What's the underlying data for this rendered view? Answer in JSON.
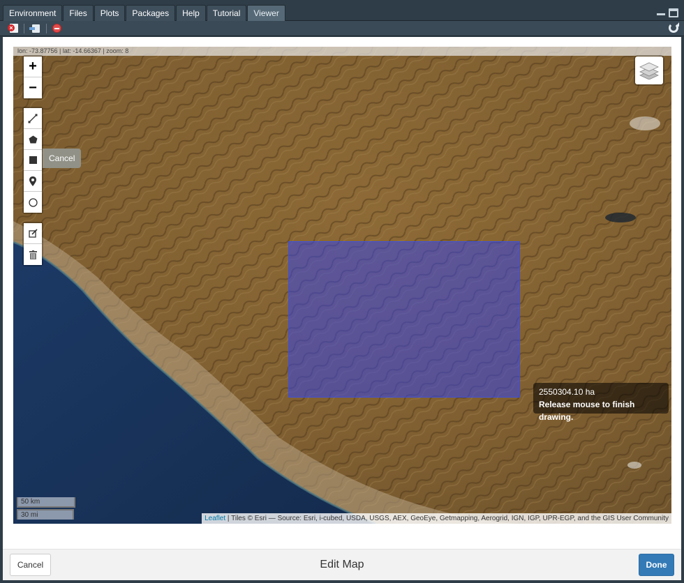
{
  "tabs": [
    {
      "label": "Environment"
    },
    {
      "label": "Files"
    },
    {
      "label": "Plots"
    },
    {
      "label": "Packages"
    },
    {
      "label": "Help"
    },
    {
      "label": "Tutorial"
    },
    {
      "label": "Viewer",
      "active": true
    }
  ],
  "toolbar": {
    "icons": [
      "clear-viewer-icon",
      "export-icon",
      "stop-icon",
      "refresh-icon"
    ]
  },
  "map": {
    "coords_readout": "lon: -73.87756 | lat: -14.66367 | zoom: 8",
    "zoom_in_label": "+",
    "zoom_out_label": "−",
    "draw_tools": [
      "polyline-icon",
      "polygon-icon",
      "rectangle-icon",
      "marker-icon",
      "circle-icon"
    ],
    "edit_tools": [
      "edit-layers-icon",
      "delete-layers-icon"
    ],
    "cancel_label": "Cancel",
    "layers_icon": "layers-icon",
    "tooltip_area": "2550304.10 ha",
    "tooltip_hint": "Release mouse to finish drawing.",
    "scale_km": "50 km",
    "scale_mi": "30 mi",
    "attribution_link": "Leaflet",
    "attribution_text": " | Tiles © Esri — Source: Esri, i-cubed, USDA, USGS, AEX, GeoEye, Getmapping, Aerogrid, IGN, IGP, UPR-EGP, and the GIS User Community",
    "selection_color": "#3c50e0"
  },
  "footer": {
    "cancel_label": "Cancel",
    "title": "Edit Map",
    "done_label": "Done",
    "done_color": "#337ab7"
  }
}
